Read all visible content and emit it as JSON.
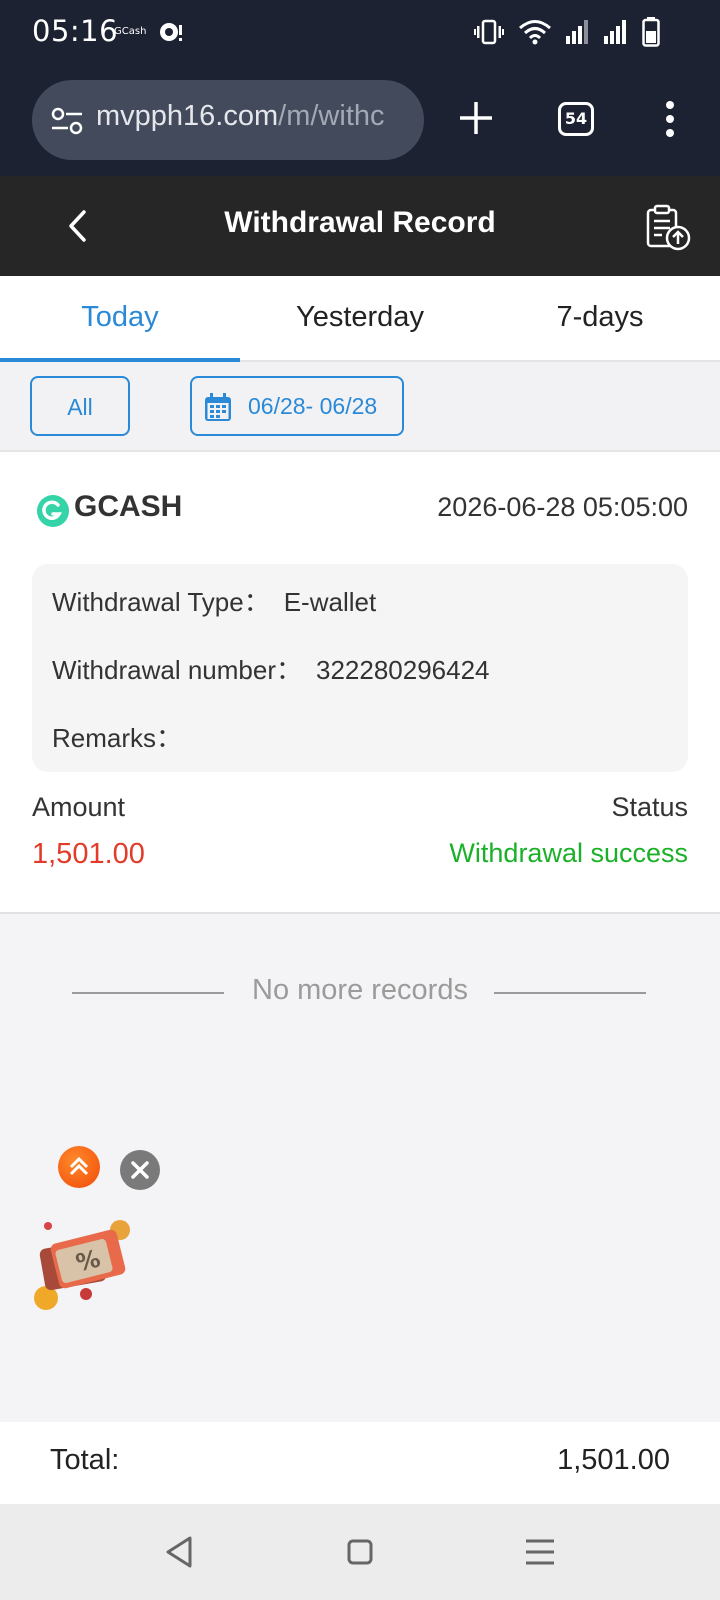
{
  "status_bar": {
    "time": "05:16",
    "notification_app": "GCash",
    "icons": [
      "vibrate-icon",
      "wifi-icon",
      "signal-icon",
      "signal-icon",
      "battery-icon"
    ]
  },
  "browser": {
    "url_host": "mvpph16.com",
    "url_path": "/m/withc",
    "tab_count": "54",
    "icons": [
      "tune-icon",
      "plus-icon",
      "more-vert-icon"
    ]
  },
  "header": {
    "title": "Withdrawal Record",
    "icons": [
      "back-arrow-icon",
      "export-clipboard-icon"
    ]
  },
  "tabs": [
    {
      "label": "Today",
      "active": true
    },
    {
      "label": "Yesterday",
      "active": false
    },
    {
      "label": "7-days",
      "active": false
    }
  ],
  "filters": {
    "all_label": "All",
    "date_range": "06/28- 06/28"
  },
  "record": {
    "channel": "GCASH",
    "datetime": "2026-06-28 05:05:00",
    "type_label": "Withdrawal Type：",
    "type_value": "E-wallet",
    "number_label": "Withdrawal number：",
    "number_value": "322280296424",
    "remarks_label": "Remarks：",
    "remarks_value": "",
    "amount_label": "Amount",
    "amount_value": "1,501.00",
    "status_label": "Status",
    "status_value": "Withdrawal success"
  },
  "list_end": "No more records",
  "total": {
    "label": "Total:",
    "value": "1,501.00"
  },
  "colors": {
    "accent": "#2a8ad8",
    "amount": "#e23b2a",
    "success": "#1ab028",
    "header_bg": "#262626",
    "chrome_bg": "#1c2232"
  }
}
